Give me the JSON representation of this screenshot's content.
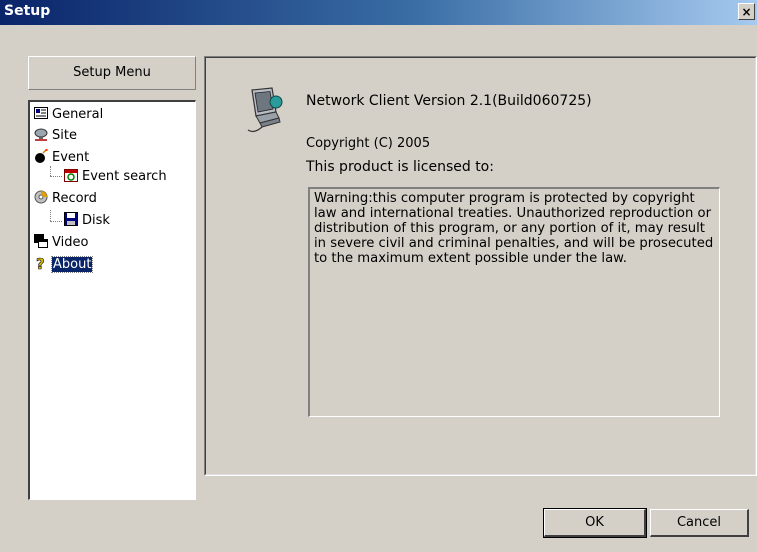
{
  "window": {
    "title": "Setup",
    "close_glyph": "×"
  },
  "sidebar": {
    "header": "Setup Menu",
    "items": [
      {
        "label": "General",
        "icon": "general-card-icon"
      },
      {
        "label": "Site",
        "icon": "site-network-icon"
      },
      {
        "label": "Event",
        "icon": "event-bomb-icon"
      },
      {
        "label": "Event search",
        "icon": "event-search-calendar-icon"
      },
      {
        "label": "Record",
        "icon": "record-disc-icon"
      },
      {
        "label": "Disk",
        "icon": "disk-floppy-icon"
      },
      {
        "label": "Video",
        "icon": "video-windows-icon"
      },
      {
        "label": "About",
        "icon": "about-question-icon",
        "selected": true
      }
    ]
  },
  "about": {
    "icon": "network-pc-icon",
    "version": "Network Client Version 2.1(Build060725)",
    "copyright": "Copyright (C) 2005",
    "licensed_to": "This product is licensed to:",
    "warning": "Warning:this computer program is protected by copyright law and international treaties. Unauthorized reproduction or distribution of this program, or any portion of it, may result in severe civil and criminal penalties, and will be prosecuted to the maximum extent possible under the law."
  },
  "buttons": {
    "ok": "OK",
    "cancel": "Cancel"
  },
  "colors": {
    "titlebar_start": "#0a246a",
    "titlebar_end": "#a6caf0",
    "selection": "#0a246a",
    "face": "#d4d0c8"
  }
}
